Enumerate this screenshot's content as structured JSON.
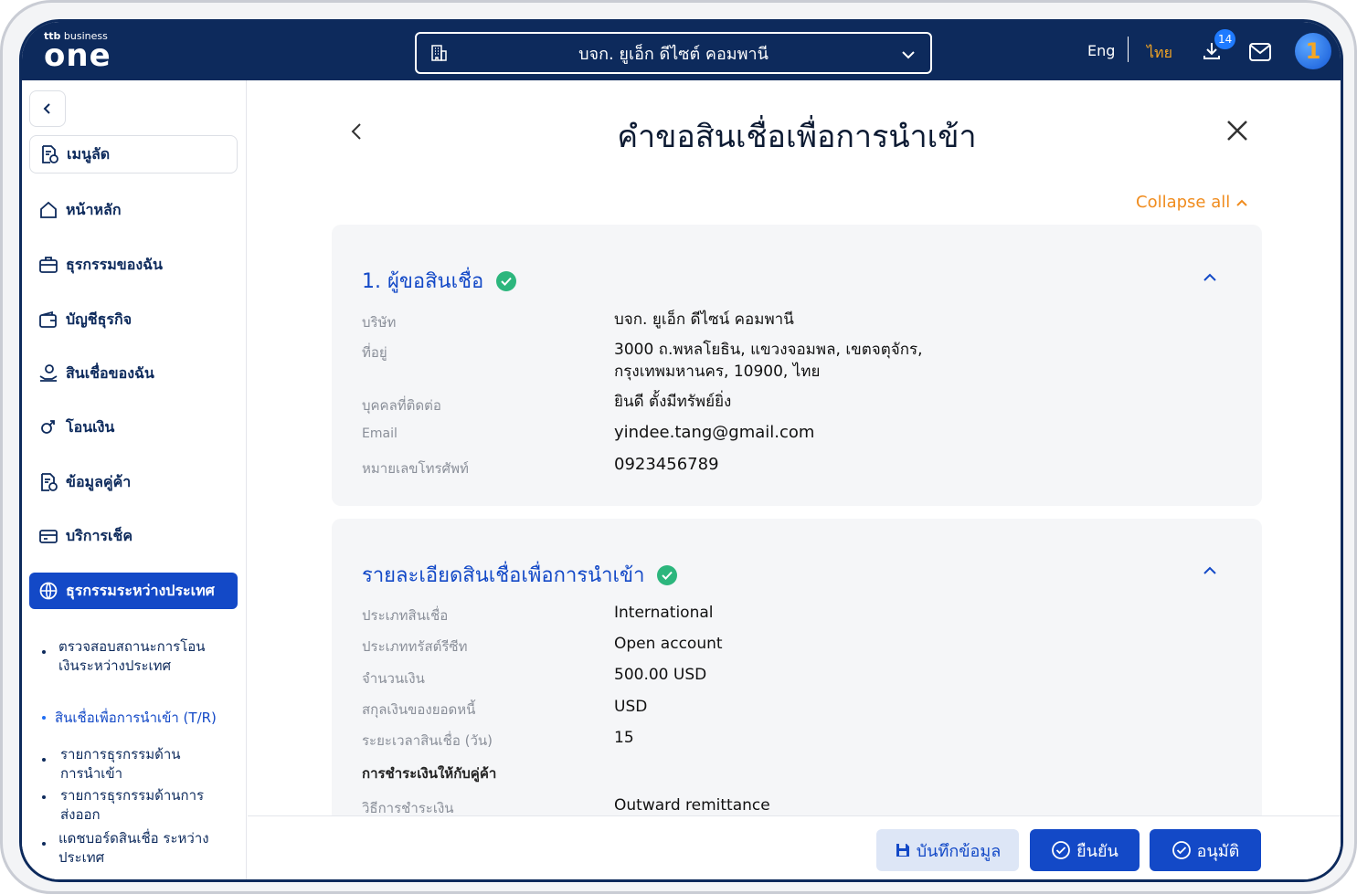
{
  "header": {
    "logo_top": "ttb",
    "logo_top_suffix": "business",
    "logo_main": "one",
    "company": "บจก. ยูเอ็ก ดีไซต์ คอมพานี",
    "lang_en": "Eng",
    "lang_th": "ไทย",
    "download_badge": "14",
    "avatar_letter": "1"
  },
  "sidebar": {
    "shortcut": "เมนูลัด",
    "items": [
      {
        "label": "หน้าหลัก",
        "icon": "home-icon"
      },
      {
        "label": "ธุรกรรมของฉัน",
        "icon": "briefcase-icon"
      },
      {
        "label": "บัญชีธุรกิจ",
        "icon": "wallet-icon"
      },
      {
        "label": "สินเชื่อของฉัน",
        "icon": "loan-icon"
      },
      {
        "label": "โอนเงิน",
        "icon": "transfer-icon"
      },
      {
        "label": "ข้อมูลคู่ค้า",
        "icon": "partner-icon"
      },
      {
        "label": "บริการเช็ค",
        "icon": "cheque-icon"
      },
      {
        "label": "ธุรกรรมระหว่างประเทศ",
        "icon": "globe-icon"
      }
    ],
    "sub_items": [
      "ตรวจสอบสถานะการโอนเงินระหว่างประเทศ",
      "สินเชื่อเพื่อการนำเข้า (T/R)",
      "รายการธุรกรรมด้านการนำเข้า",
      "รายการธุรกรรมด้านการส่งออก",
      "แดชบอร์ดสินเชื่อ ระหว่างประเทศ"
    ]
  },
  "page": {
    "title": "คำขอสินเชื่อเพื่อการนำเข้า",
    "collapse_all": "Collapse all"
  },
  "section1": {
    "title": "1. ผู้ขอสินเชื่อ",
    "rows": [
      {
        "label": "บริษัท",
        "value": "บจก. ยูเอ็ก ดีไซน์ คอมพานี"
      },
      {
        "label": "ที่อยู่",
        "value": "3000 ถ.พหลโยธิน, แขวงจอมพล, เขตจตุจักร,",
        "value2": "กรุงเทพมหานคร, 10900, ไทย"
      },
      {
        "label": "บุคคลที่ติดต่อ",
        "value": "ยินดี ตั้งมีทรัพย์ยิ่ง"
      },
      {
        "label": "Email",
        "value": "yindee.tang@gmail.com"
      },
      {
        "label": "หมายเลขโทรศัพท์",
        "value": "0923456789"
      }
    ]
  },
  "section2": {
    "title": "รายละเอียดสินเชื่อเพื่อการนำเข้า",
    "rows": [
      {
        "label": "ประเภทสินเชื่อ",
        "value": "International"
      },
      {
        "label": "ประเภททรัสต์รีซีท",
        "value": "Open account"
      },
      {
        "label": "จำนวนเงิน",
        "value": "500.00 USD"
      },
      {
        "label": "สกุลเงินของยอดหนี้",
        "value": "USD"
      },
      {
        "label": "ระยะเวลาสินเชื่อ (วัน)",
        "value": "15"
      }
    ],
    "subheading": "การชำระเงินให้กับคู่ค้า",
    "rows2": [
      {
        "label": "วิธีการชำระเงิน",
        "value": "Outward remittance"
      }
    ]
  },
  "footer": {
    "save": "บันทึกข้อมูล",
    "confirm": "ยืนยัน",
    "approve": "อนุมัติ"
  },
  "colors": {
    "navy": "#0d2a5c",
    "primary": "#1349c7",
    "accent_orange": "#f08c1e",
    "success": "#2cb67d"
  }
}
